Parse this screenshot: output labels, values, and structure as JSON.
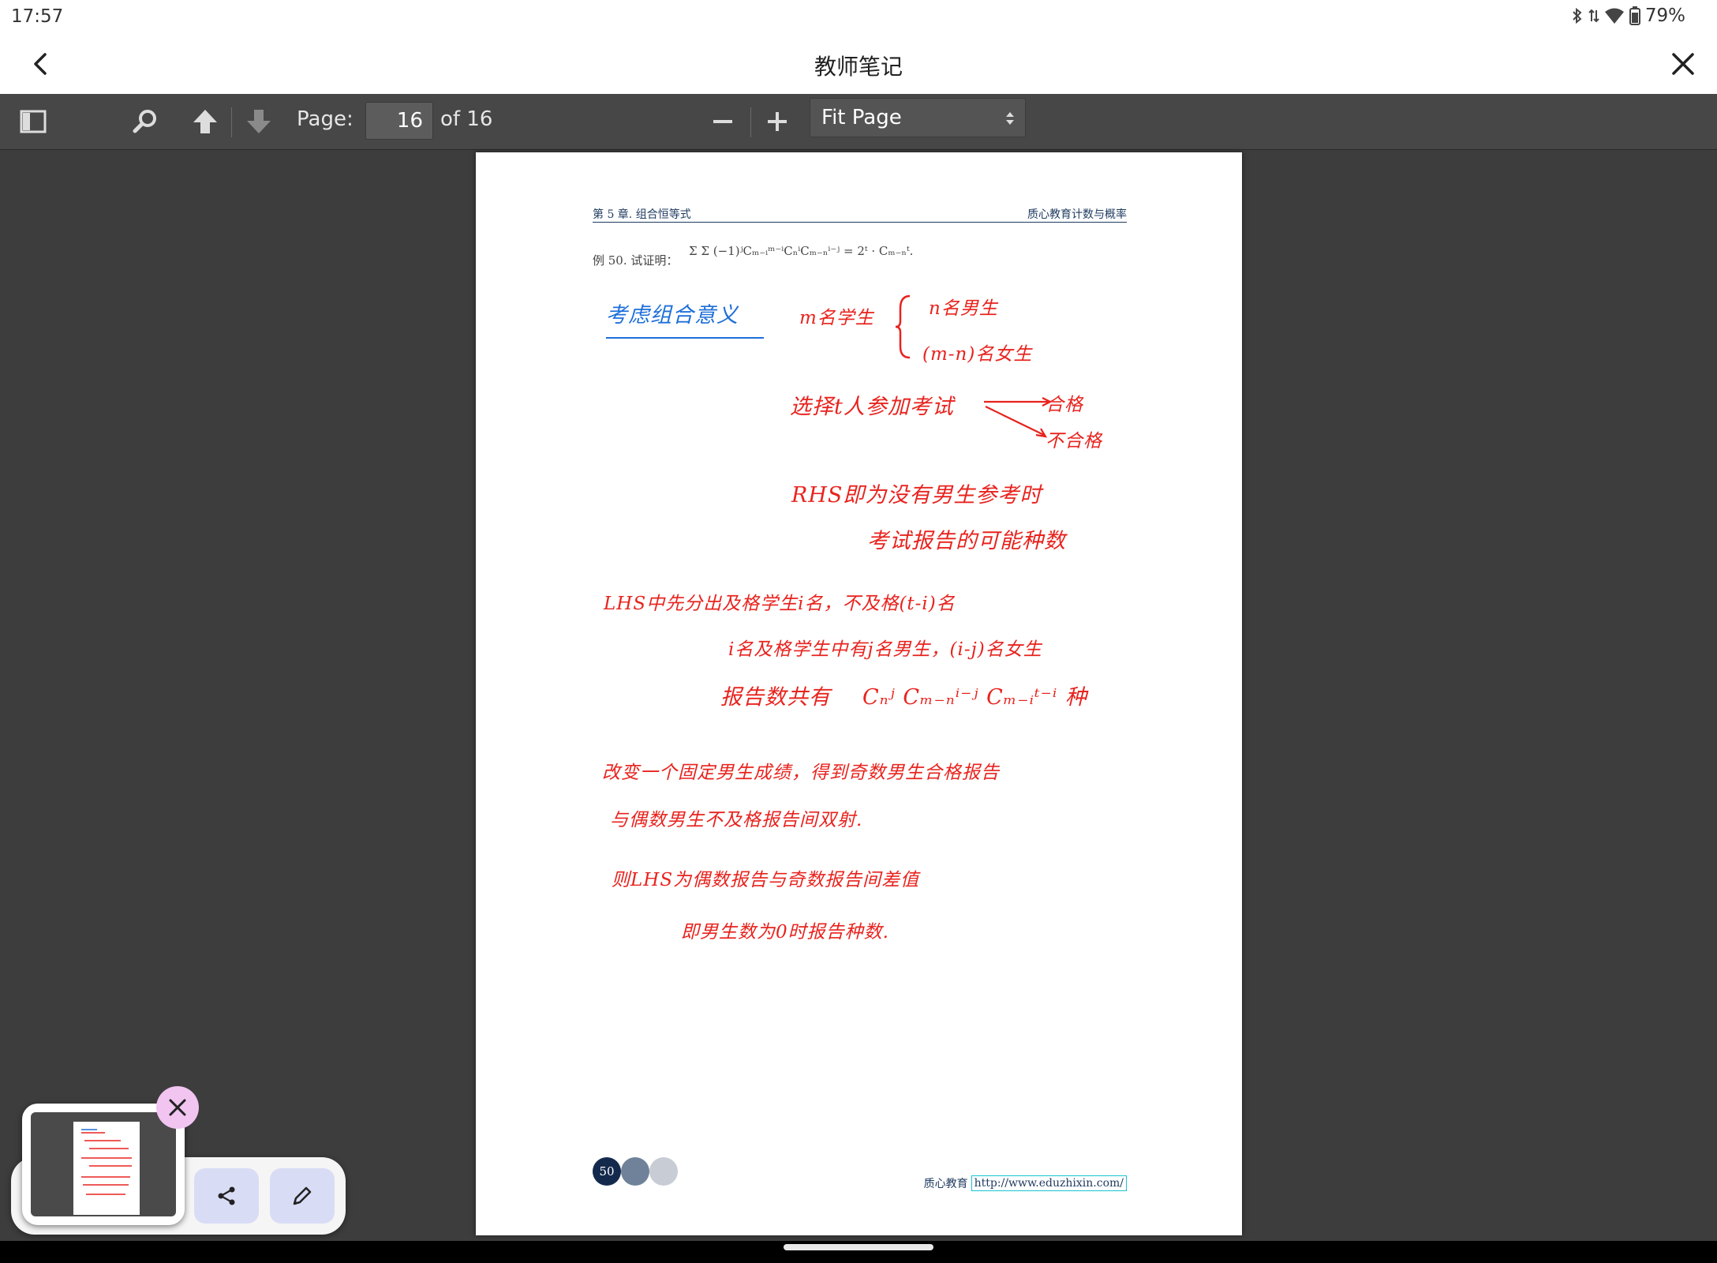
{
  "status": {
    "time": "17:57",
    "battery": "79%"
  },
  "app": {
    "title": "教师笔记"
  },
  "toolbar": {
    "page_label": "Page:",
    "page_value": "16",
    "page_total": "of 16",
    "zoom_value": "Fit Page"
  },
  "page": {
    "header_left": "第 5 章. 组合恒等式",
    "header_right": "质心教育计数与概率",
    "example_label": "例 50. 试证明：",
    "formula": "Σ Σ (−1)ʲCₘ₋ᵢᵐ⁻ⁱCₙⁱCₘ₋ₙⁱ⁻ʲ = 2ᵗ · Cₘ₋ₙᵗ.",
    "handwriting": {
      "blue_title": "考虑组合意义",
      "line1": "m名学生",
      "brace_a": "n名男生",
      "brace_b": "(m-n)名女生",
      "line2": "选择t人参加考试",
      "branch_a": "合格",
      "branch_b": "不合格",
      "line3": "RHS即为没有男生参考时",
      "line4": "考试报告的可能种数",
      "line5": "LHS中先分出及格学生i名，不及格(t-i)名",
      "line6": "i名及格学生中有j名男生，(i-j)名女生",
      "line7": "报告数共有",
      "line7_formula": "Cₙʲ Cₘ₋ₙⁱ⁻ʲ Cₘ₋ᵢᵗ⁻ⁱ 种",
      "line8": "改变一个固定男生成绩，得到奇数男生合格报告",
      "line9": "与偶数男生不及格报告间双射.",
      "line10": "则LHS为偶数报告与奇数报告间差值",
      "line11": "即男生数为0时报告种数."
    },
    "page_number": "50",
    "footer_brand": "质心教育",
    "footer_url": "http://www.eduzhixin.com/"
  },
  "colors": {
    "ink_red": "#e8231e",
    "ink_blue": "#1e6fd9",
    "toolbar": "#474747",
    "viewer_bg": "#3d3d3d"
  }
}
